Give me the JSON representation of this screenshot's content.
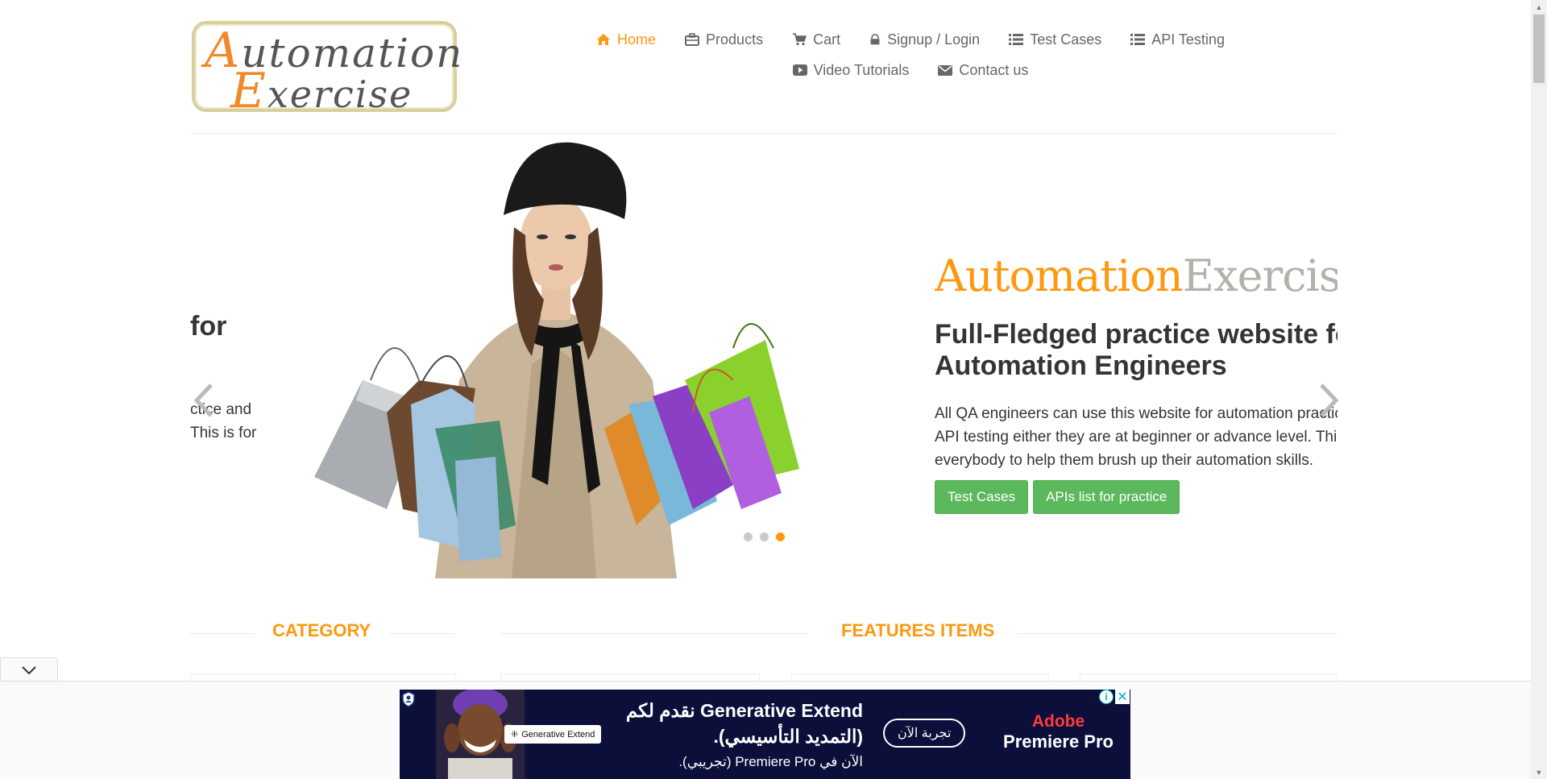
{
  "logo": {
    "line1_cap": "A",
    "line1_rest": "utomation",
    "line2_cap": "E",
    "line2_rest": "xercise"
  },
  "nav": {
    "items": [
      {
        "label": "Home",
        "icon": "home-icon",
        "active": true
      },
      {
        "label": "Products",
        "icon": "briefcase-icon"
      },
      {
        "label": "Cart",
        "icon": "cart-icon"
      },
      {
        "label": "Signup / Login",
        "icon": "lock-icon"
      },
      {
        "label": "Test Cases",
        "icon": "list-icon"
      },
      {
        "label": "API Testing",
        "icon": "list-icon"
      },
      {
        "label": "Video Tutorials",
        "icon": "youtube-play-icon"
      },
      {
        "label": "Contact us",
        "icon": "envelope-icon"
      }
    ]
  },
  "carousel": {
    "prev_slide_partial": {
      "title": "for",
      "line1": "ctice and",
      "line2": "This is for"
    },
    "brand_part1": "Automation",
    "brand_part2": "Exercise",
    "title_line1": "Full-Fledged practice website for",
    "title_line2": "Automation Engineers",
    "desc_line1": "All QA engineers can use this website for automation practice and",
    "desc_line2": "API testing either they are at beginner or advance level. This is for",
    "desc_line3": "everybody to help them brush up their automation skills.",
    "btn_test_cases": "Test Cases",
    "btn_apis": "APIs list for practice",
    "dots": 3,
    "active_dot": 2
  },
  "sections": {
    "category": "Category",
    "features": "Features Items"
  },
  "ad": {
    "badge": "Generative Extend",
    "headline_line1": "Generative Extend نقدم لكم",
    "headline_line2": "(التمديد التأسيسي).",
    "sub": "الآن في Premiere Pro (تجريبي).",
    "cta": "تجربة الآن",
    "brand1": "Adobe",
    "brand2": "Premiere Pro",
    "info_icon": "i",
    "close_icon": "✕"
  },
  "colors": {
    "accent": "#fe980f",
    "button": "#5cb85c",
    "text": "#363432"
  }
}
